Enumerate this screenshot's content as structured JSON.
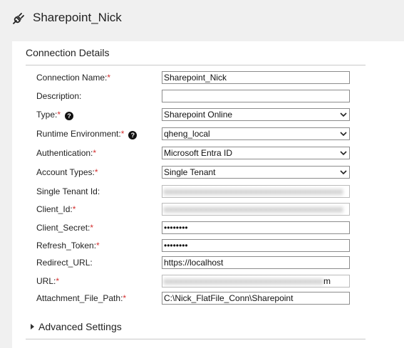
{
  "header": {
    "title": "Sharepoint_Nick",
    "icon": "plug-icon"
  },
  "section": {
    "title": "Connection Details"
  },
  "fields": {
    "connection_name": {
      "label": "Connection Name:",
      "required": "*",
      "value": "Sharepoint_Nick"
    },
    "description": {
      "label": "Description:",
      "value": ""
    },
    "type": {
      "label": "Type:",
      "required": "*",
      "value": "Sharepoint Online"
    },
    "runtime": {
      "label": "Runtime Environment:",
      "required": "*",
      "value": "qheng_local"
    },
    "authentication": {
      "label": "Authentication:",
      "required": "*",
      "value": "Microsoft Entra ID"
    },
    "account_types": {
      "label": "Account Types:",
      "required": "*",
      "value": "Single Tenant"
    },
    "tenant_id": {
      "label": "Single Tenant Id:",
      "value": ""
    },
    "client_id": {
      "label": "Client_Id:",
      "required": "*",
      "value": ""
    },
    "client_secret": {
      "label": "Client_Secret:",
      "required": "*",
      "value": "••••••••"
    },
    "refresh_token": {
      "label": "Refresh_Token:",
      "required": "*",
      "value": "••••••••"
    },
    "redirect_url": {
      "label": "Redirect_URL:",
      "value": "https://localhost"
    },
    "url": {
      "label": "URL:",
      "required": "*",
      "value": "",
      "visible_suffix": "m"
    },
    "attachment_path": {
      "label": "Attachment_File_Path:",
      "required": "*",
      "value": "C:\\Nick_FlatFile_Conn\\Sharepoint"
    }
  },
  "help_glyph": "?",
  "advanced": {
    "label": "Advanced Settings"
  },
  "colors": {
    "required": "#d32f2f",
    "background": "#f0f0f0",
    "panel": "#ffffff"
  }
}
